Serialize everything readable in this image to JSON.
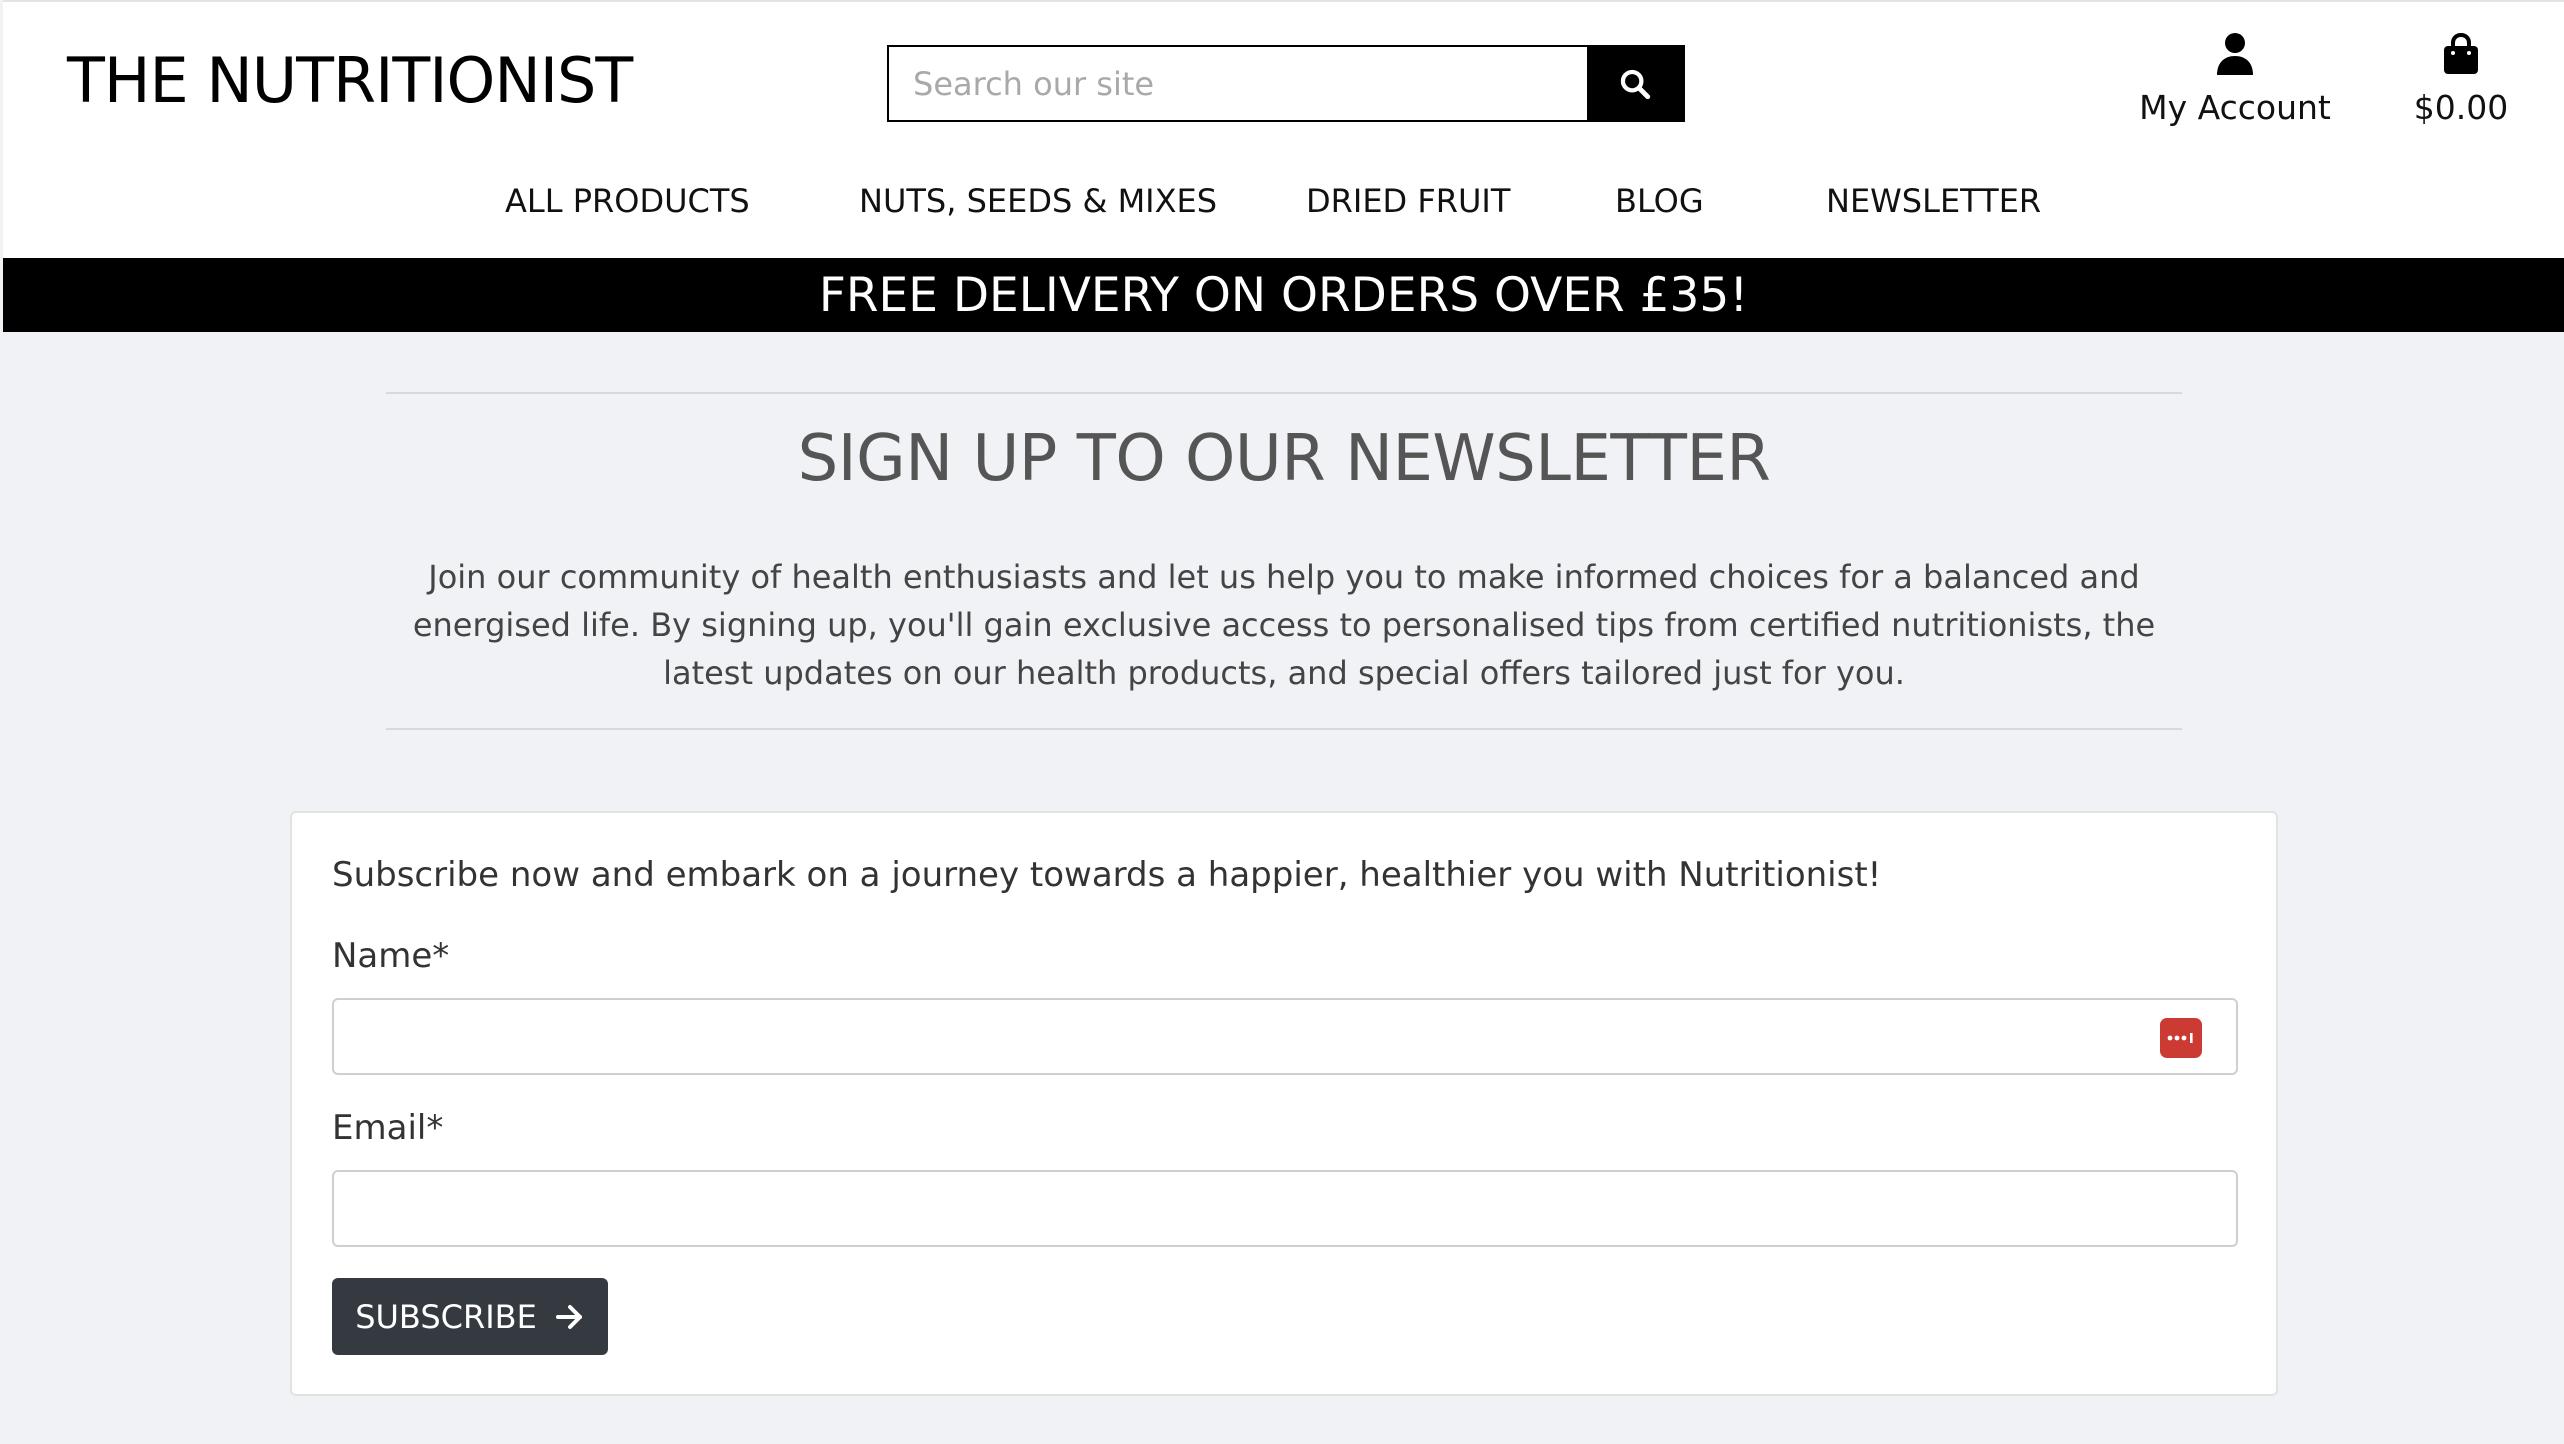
{
  "header": {
    "logo": "THE NUTRITIONIST",
    "search_placeholder": "Search our site",
    "account_label": "My Account",
    "cart_total": "$0.00"
  },
  "nav": {
    "items": [
      {
        "label": "ALL PRODUCTS"
      },
      {
        "label": "NUTS, SEEDS & MIXES"
      },
      {
        "label": "DRIED FRUIT"
      },
      {
        "label": "BLOG"
      },
      {
        "label": "NEWSLETTER"
      }
    ]
  },
  "banner": {
    "text": "FREE DELIVERY ON ORDERS OVER £35!"
  },
  "newsletter": {
    "title": "SIGN UP TO OUR NEWSLETTER",
    "intro": "Join our community of health enthusiasts and let us help you to make informed choices for a balanced and energised life. By signing up, you'll gain exclusive access to personalised tips from certified nutritionists, the latest updates on our health products, and special offers tailored just for you.",
    "form": {
      "intro": "Subscribe now and embark on a journey towards a happier, healthier you with Nutritionist!",
      "name_label": "Name*",
      "name_value": "",
      "email_label": "Email*",
      "email_value": "",
      "submit_label": "SUBSCRIBE"
    }
  },
  "icons": {
    "search": "search-icon",
    "account": "user-icon",
    "cart": "shopping-bag-icon",
    "password_manager": "password-manager-icon",
    "submit_arrow": "arrow-right-icon"
  },
  "colors": {
    "page_bg": "#f1f2f5",
    "banner_bg": "#000000",
    "button_bg": "#343a40",
    "password_icon": "#cc3b33"
  }
}
